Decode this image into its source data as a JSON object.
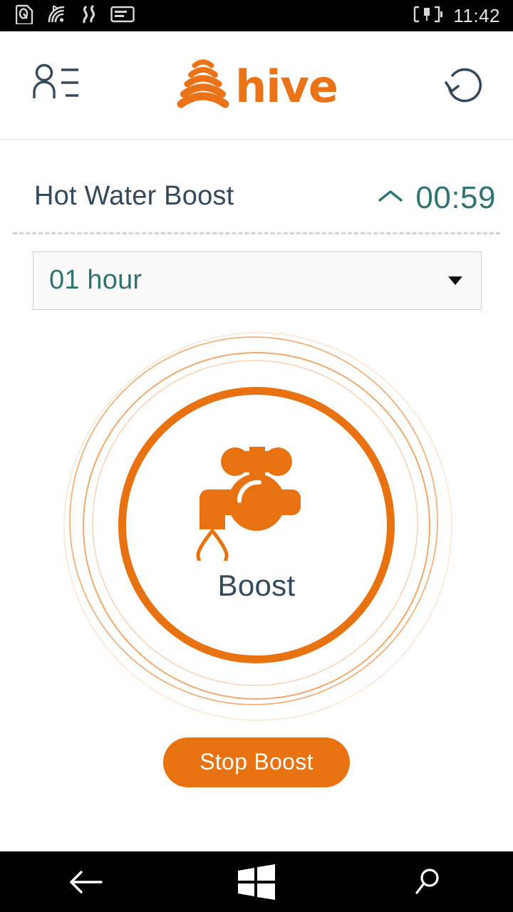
{
  "status_bar": {
    "icons": [
      {
        "name": "sim-card-icon"
      },
      {
        "name": "wifi-signal-icon"
      },
      {
        "name": "cellular-signal-icon"
      },
      {
        "name": "sms-message-icon"
      }
    ],
    "battery_icon": "battery-charging-icon",
    "clock": "11:42"
  },
  "app_header": {
    "account_icon": "contacts-list-icon",
    "brand_mark_icon": "hive-arcs-logo-icon",
    "brand_name": "hive",
    "refresh_icon": "refresh-icon"
  },
  "boost": {
    "title": "Hot Water Boost",
    "timer_chevron_icon": "chevron-up-icon",
    "timer": "00:59",
    "duration": {
      "selected": "01 hour",
      "caret_icon": "caret-down-icon"
    },
    "dial": {
      "tap_icon": "water-tap-icon",
      "label": "Boost"
    },
    "stop_label": "Stop Boost"
  },
  "system_nav": {
    "back_icon": "back-arrow-icon",
    "start_icon": "windows-start-icon",
    "search_icon": "search-icon"
  },
  "colors": {
    "brand_orange": "#e8720f",
    "teal": "#2f7471",
    "slate": "#34495a",
    "status_bar_bg": "#000000",
    "page_bg": "#ffffff",
    "field_bg": "#fafafa",
    "field_border": "#cfcfcf",
    "divider": "#d2d2d2"
  }
}
